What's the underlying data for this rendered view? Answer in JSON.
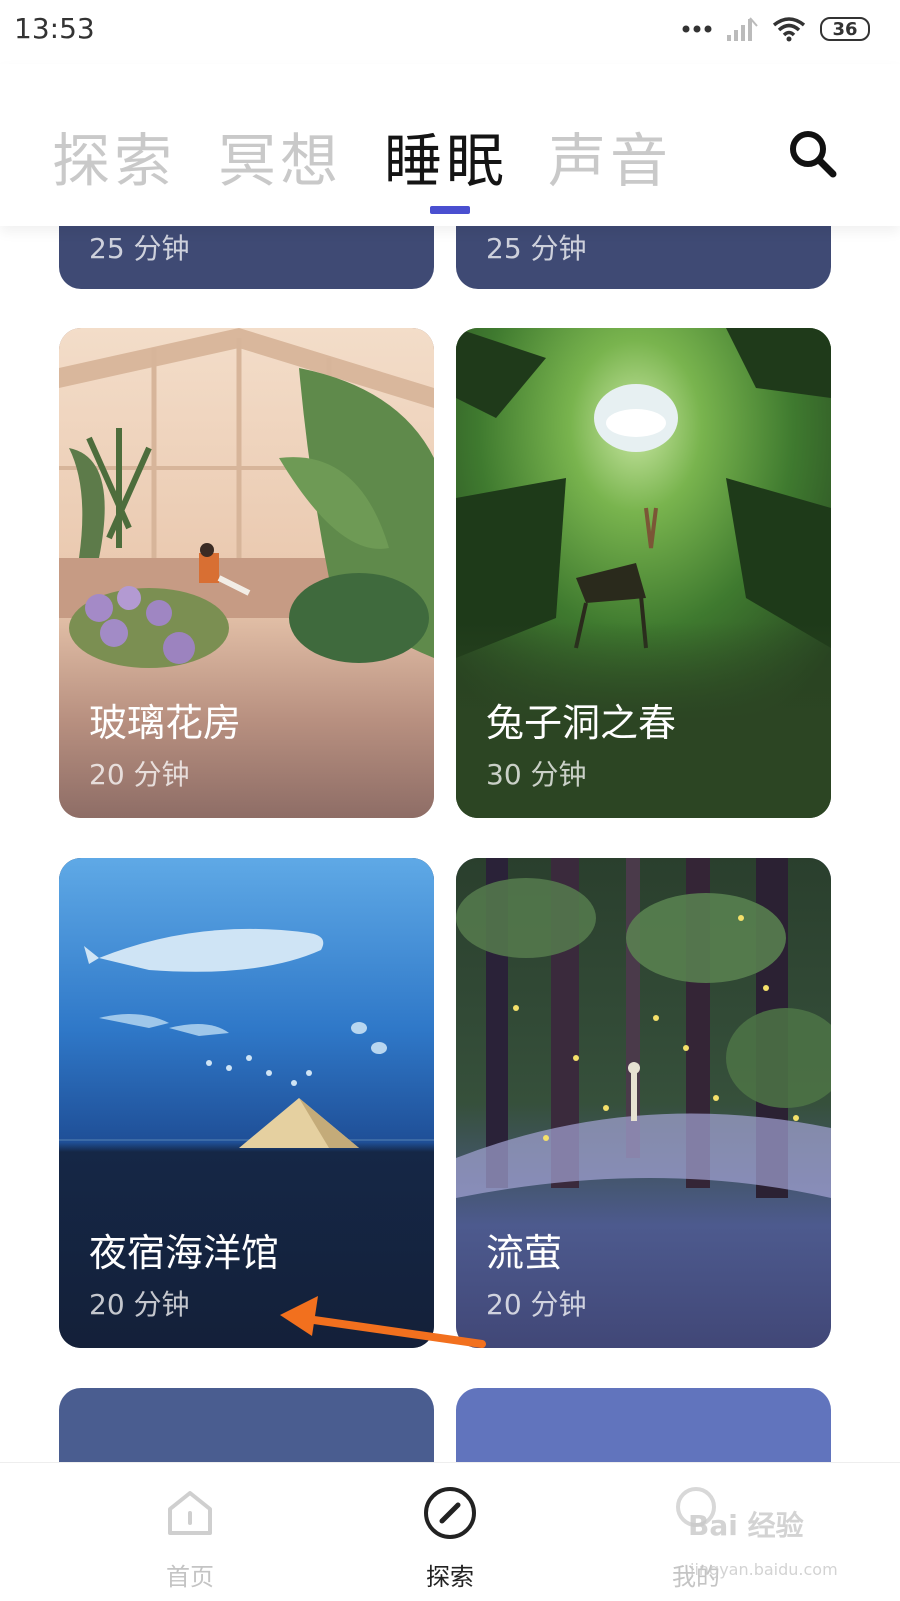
{
  "status_bar": {
    "time": "13:53",
    "battery": "36"
  },
  "tabs": [
    {
      "label": "探索",
      "active": false
    },
    {
      "label": "冥想",
      "active": false
    },
    {
      "label": "睡眠",
      "active": true
    },
    {
      "label": "声音",
      "active": false
    }
  ],
  "colors": {
    "accent": "#4a4fd0",
    "arrow": "#f2701e"
  },
  "cards": [
    {
      "title": "",
      "duration": "25 分钟"
    },
    {
      "title": "",
      "duration": "25 分钟"
    },
    {
      "title": "玻璃花房",
      "duration": "20 分钟"
    },
    {
      "title": "兔子洞之春",
      "duration": "30 分钟"
    },
    {
      "title": "夜宿海洋馆",
      "duration": "20 分钟"
    },
    {
      "title": "流萤",
      "duration": "20 分钟"
    }
  ],
  "bottom_nav": [
    {
      "label": "首页",
      "icon": "home-icon",
      "active": false
    },
    {
      "label": "探索",
      "icon": "compass-icon",
      "active": true
    },
    {
      "label": "我的",
      "icon": "profile-icon",
      "active": false
    }
  ],
  "watermark": {
    "text": "Bai 经验",
    "url": "jingyan.baidu.com"
  }
}
